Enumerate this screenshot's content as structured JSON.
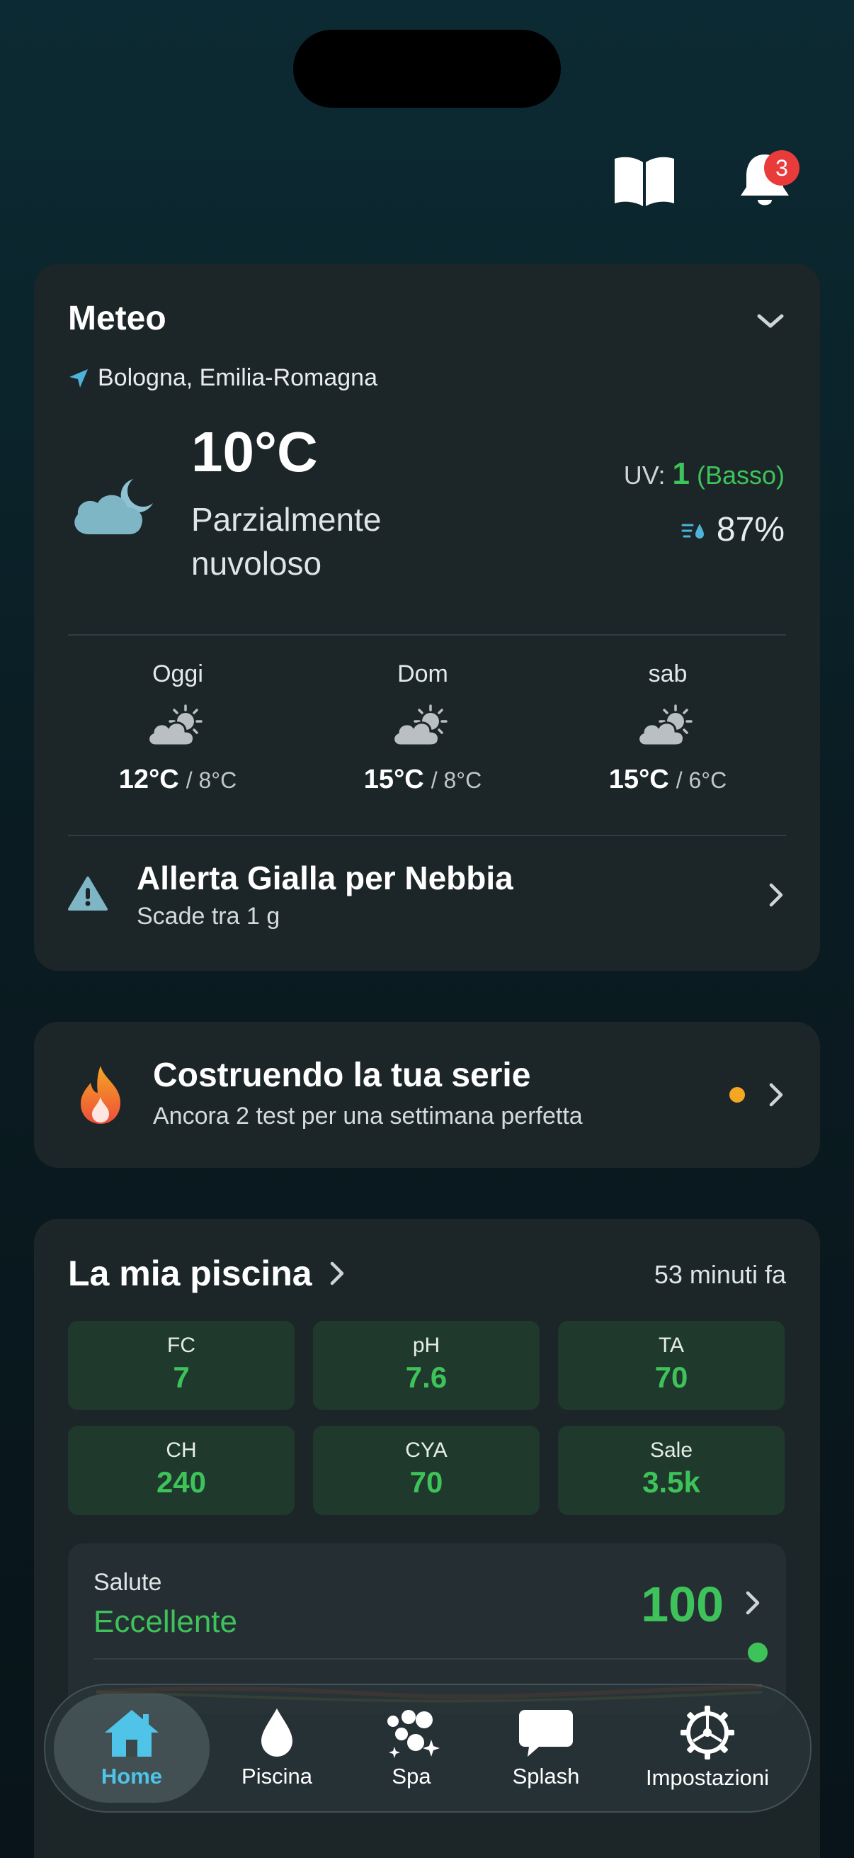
{
  "header": {
    "notifications_count": "3"
  },
  "weather": {
    "title": "Meteo",
    "location": "Bologna, Emilia-Romagna",
    "temperature": "10°C",
    "condition_line1": "Parzialmente",
    "condition_line2": "nuvoloso",
    "uv_label": "UV:",
    "uv_value": "1",
    "uv_level": "(Basso)",
    "humidity": "87%",
    "forecast": [
      {
        "day": "Oggi",
        "high": "12°C",
        "low": "8°C"
      },
      {
        "day": "Dom",
        "high": "15°C",
        "low": "8°C"
      },
      {
        "day": "sab",
        "high": "15°C",
        "low": "6°C"
      }
    ],
    "alert_title": "Allerta Gialla per Nebbia",
    "alert_subtitle": "Scade tra 1 g"
  },
  "streak": {
    "title": "Costruendo la tua serie",
    "subtitle": "Ancora 2 test per una settimana perfetta"
  },
  "pool": {
    "title": "La mia piscina",
    "updated": "53 minuti fa",
    "readings": [
      {
        "label": "FC",
        "value": "7"
      },
      {
        "label": "pH",
        "value": "7.6"
      },
      {
        "label": "TA",
        "value": "70"
      },
      {
        "label": "CH",
        "value": "240"
      },
      {
        "label": "CYA",
        "value": "70"
      },
      {
        "label": "Sale",
        "value": "3.5k"
      }
    ],
    "health_label": "Salute",
    "health_status": "Eccellente",
    "health_score": "100"
  },
  "nav": {
    "items": [
      {
        "label": "Home",
        "icon": "home-icon"
      },
      {
        "label": "Piscina",
        "icon": "drop-icon"
      },
      {
        "label": "Spa",
        "icon": "bubbles-icon"
      },
      {
        "label": "Splash",
        "icon": "chat-icon"
      },
      {
        "label": "Impostazioni",
        "icon": "gear-icon"
      }
    ],
    "active": "Home"
  },
  "colors": {
    "accent_green": "#3ec35a",
    "active_nav": "#4fc3e8",
    "badge_red": "#ea3b3b",
    "streak_dot": "#f5a623"
  }
}
